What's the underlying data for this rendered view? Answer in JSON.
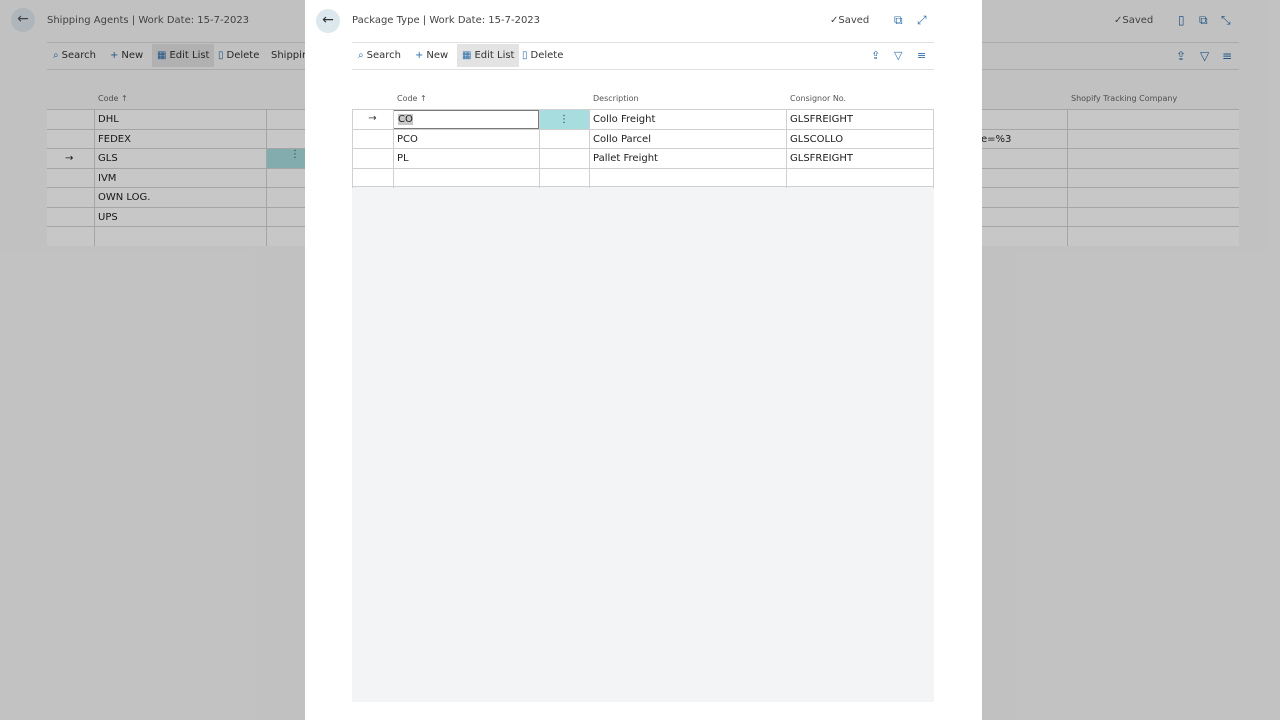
{
  "background_page": {
    "title": "Shipping Agents | Work Date: 15-7-2023",
    "saved": "Saved",
    "toolbar": {
      "search": "Search",
      "new": "New",
      "edit_list": "Edit List",
      "delete": "Delete",
      "extra": "Shippin"
    },
    "columns": {
      "code": "Code ↑",
      "shopify": "Shopify Tracking Company"
    },
    "rows": [
      {
        "code": "DHL",
        "other": ""
      },
      {
        "code": "FEDEX",
        "other": "e=%3"
      },
      {
        "code": "GLS",
        "other": ""
      },
      {
        "code": "IVM",
        "other": ""
      },
      {
        "code": "OWN LOG.",
        "other": ""
      },
      {
        "code": "UPS",
        "other": ""
      },
      {
        "code": "",
        "other": ""
      }
    ]
  },
  "dialog": {
    "title": "Package Type | Work Date: 15-7-2023",
    "saved": "Saved",
    "toolbar": {
      "search": "Search",
      "new": "New",
      "edit_list": "Edit List",
      "delete": "Delete"
    },
    "columns": {
      "code": "Code ↑",
      "description": "Description",
      "consignor": "Consignor No."
    },
    "rows": [
      {
        "code": "CO",
        "description": "Collo Freight",
        "consignor": "GLSFREIGHT"
      },
      {
        "code": "PCO",
        "description": "Collo Parcel",
        "consignor": "GLSCOLLO"
      },
      {
        "code": "PL",
        "description": "Pallet Freight",
        "consignor": "GLSFREIGHT"
      },
      {
        "code": "",
        "description": "",
        "consignor": ""
      }
    ],
    "current_row_marker": "→",
    "row_menu_glyph": "⋮"
  },
  "icons": {
    "back": "back-arrow-icon",
    "search": "search-icon",
    "new": "plus-icon",
    "edit_list": "edit-list-icon",
    "delete": "trash-icon",
    "saved": "checkmark-icon",
    "open_new_window": "open-new-window-icon",
    "expand": "expand-icon",
    "collapse": "collapse-icon",
    "bookmark": "bookmark-icon",
    "share": "share-icon",
    "filter": "filter-icon",
    "list": "list-view-icon"
  },
  "colors": {
    "accent": "#2f6fab",
    "selected_cell": "#a8dde0"
  }
}
